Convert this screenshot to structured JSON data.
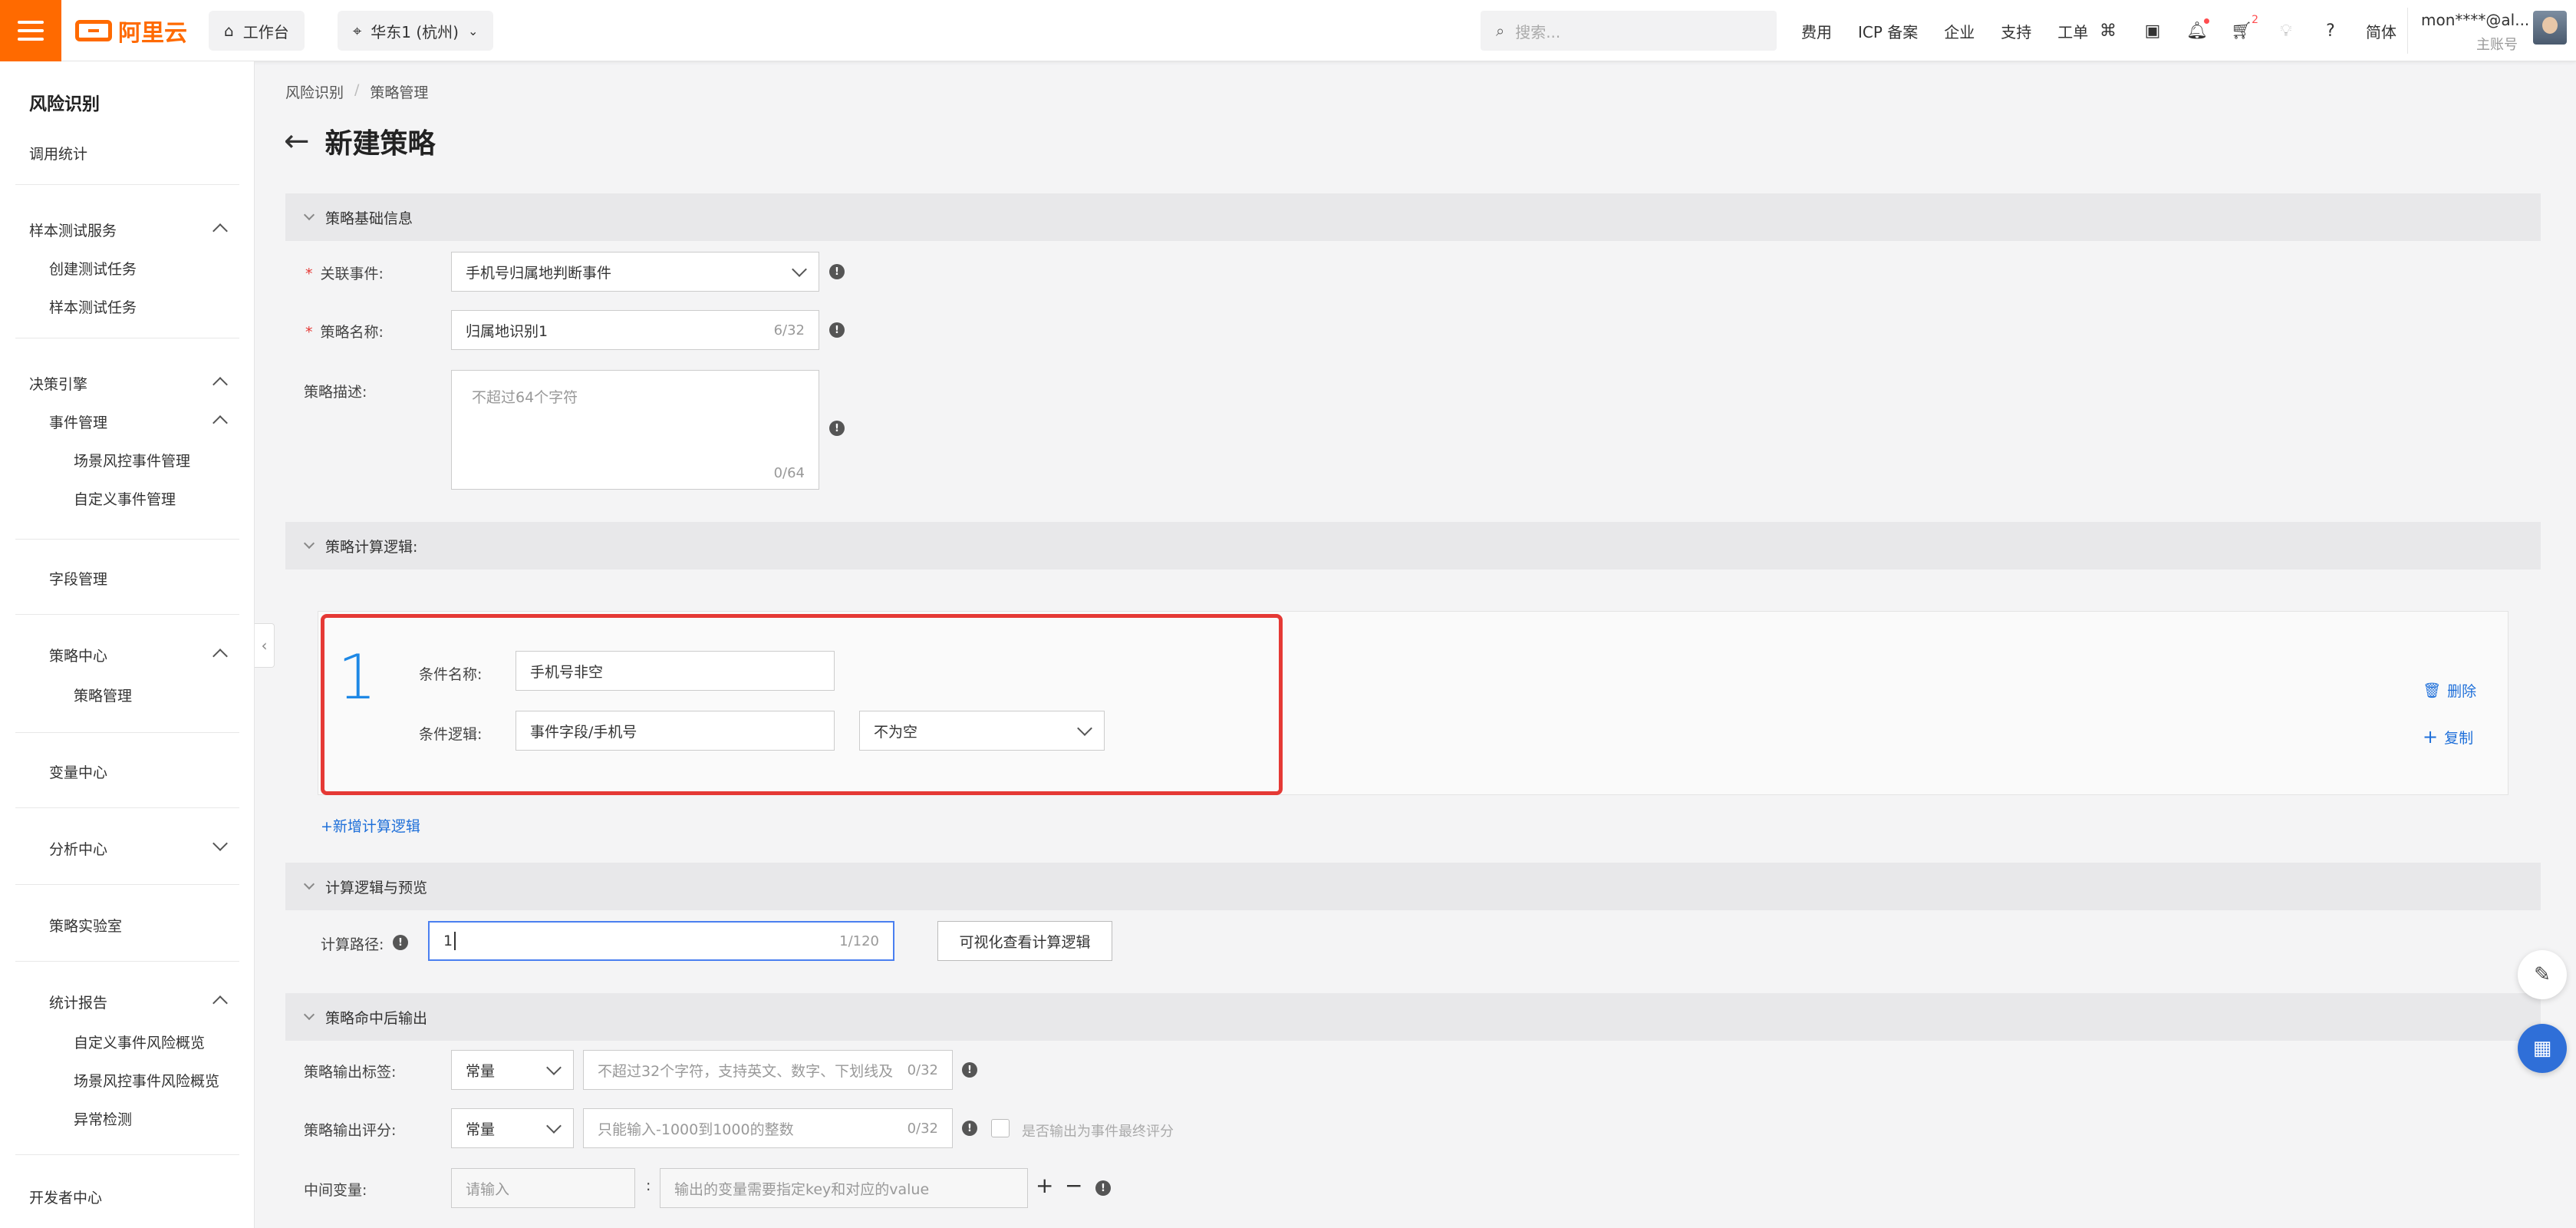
{
  "topbar": {
    "logo": "阿里云",
    "workbench": "工作台",
    "region": "华东1 (杭州)",
    "search_placeholder": "搜索...",
    "links": [
      "费用",
      "ICP 备案",
      "企业",
      "支持",
      "工单"
    ],
    "cart_badge": "2",
    "lang": "简体",
    "user_name": "mon****@al...",
    "user_role": "主账号"
  },
  "sidebar": {
    "title": "风险识别",
    "items": {
      "call_stats": "调用统计",
      "sample_service": "样本测试服务",
      "create_task": "创建测试任务",
      "sample_task": "样本测试任务",
      "decision_engine": "决策引擎",
      "event_mgmt": "事件管理",
      "scene_event": "场景风控事件管理",
      "custom_event": "自定义事件管理",
      "field_mgmt": "字段管理",
      "policy_center": "策略中心",
      "policy_mgmt": "策略管理",
      "var_center": "变量中心",
      "analysis_center": "分析中心",
      "policy_lab": "策略实验室",
      "stats_report": "统计报告",
      "custom_overview": "自定义事件风险概览",
      "scene_overview": "场景风控事件风险概览",
      "anomaly": "异常检测",
      "dev_center": "开发者中心"
    }
  },
  "breadcrumb": [
    "风险识别",
    "策略管理"
  ],
  "breadcrumb_sep": "/",
  "page_title": "新建策略",
  "sections": {
    "basic": "策略基础信息",
    "logic": "策略计算逻辑:",
    "preview": "计算逻辑与预览",
    "output": "策略命中后输出"
  },
  "basic": {
    "event_label": "关联事件:",
    "event_value": "手机号归属地判断事件",
    "name_label": "策略名称:",
    "name_value": "归属地识别1",
    "name_counter": "6/32",
    "desc_label": "策略描述:",
    "desc_placeholder": "不超过64个字符",
    "desc_counter": "0/64"
  },
  "condition": {
    "number": "1",
    "name_label": "条件名称:",
    "name_value": "手机号非空",
    "logic_label": "条件逻辑:",
    "logic_field": "事件字段/手机号",
    "logic_op": "不为空",
    "delete": "删除",
    "copy": "复制",
    "add": "+新增计算逻辑"
  },
  "preview": {
    "path_label": "计算路径:",
    "path_value": "1",
    "path_counter": "1/120",
    "visual_button": "可视化查看计算逻辑"
  },
  "output": {
    "tag_label": "策略输出标签:",
    "tag_type": "常量",
    "tag_placeholder": "不超过32个字符，支持英文、数字、下划线及",
    "tag_counter": "0/32",
    "score_label": "策略输出评分:",
    "score_type": "常量",
    "score_placeholder": "只能输入-1000到1000的整数",
    "score_counter": "0/32",
    "final_score_label": "是否输出为事件最终评分",
    "mid_label": "中间变量:",
    "mid_key_placeholder": "请输入",
    "mid_colon": ":",
    "mid_value_placeholder": "输出的变量需要指定key和对应的value"
  }
}
